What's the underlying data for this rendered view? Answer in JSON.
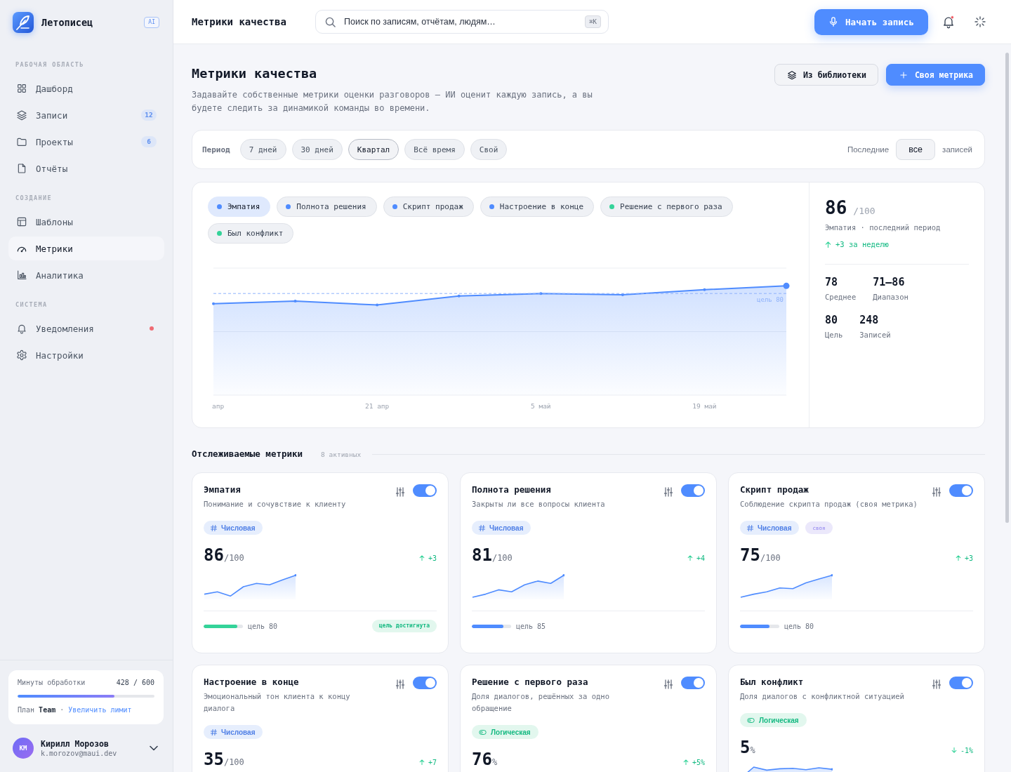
{
  "sidebar": {
    "app_name": "Летописец",
    "app_badge": "AI",
    "sections": [
      {
        "title": "РАБОЧАЯ ОБЛАСТЬ",
        "items": [
          {
            "label": "Дашборд",
            "selected": false,
            "unread": false
          },
          {
            "label": "Записи",
            "badge": "12",
            "selected": false,
            "unread": false
          },
          {
            "label": "Проекты",
            "badge": "6",
            "selected": false,
            "unread": false
          },
          {
            "label": "Отчёты",
            "selected": false,
            "unread": false
          }
        ]
      },
      {
        "title": "СОЗДАНИЕ",
        "items": [
          {
            "label": "Шаблоны",
            "selected": false,
            "unread": false
          },
          {
            "label": "Метрики",
            "selected": true,
            "unread": false
          },
          {
            "label": "Аналитика",
            "selected": false,
            "unread": false
          }
        ]
      },
      {
        "title": "СИСТЕМА",
        "items": [
          {
            "label": "Уведомления",
            "selected": false,
            "unread": true
          },
          {
            "label": "Настройки",
            "selected": false,
            "unread": false
          }
        ]
      }
    ],
    "usage": {
      "label": "Минуты обработки",
      "reading": "428 / 600",
      "level": 0.71,
      "plan": "План **Team** ·",
      "link": "Увеличить лимит"
    },
    "user": {
      "initials": "КМ",
      "name": "Кирилл Морозов",
      "email": "k.morozov@maui.dev"
    }
  },
  "header": {
    "title": "Метрики качества",
    "search": {
      "placeholder": "Поиск по записям, отчётам, людям…",
      "shortcut": "⌘K"
    },
    "record_button": "Начать запись",
    "notifications_unread": true
  },
  "page": {
    "title": "Метрики качества",
    "description": "Задавайте собственные метрики оценки разговоров — ИИ оценит каждую запись, а вы будете следить за динамикой команды во времени.",
    "buttons": [
      {
        "kind": "library",
        "label": "Из библиотеки"
      },
      {
        "kind": "create",
        "label": "Своя метрика"
      }
    ]
  },
  "period_filter": {
    "label": "Период",
    "options": [
      {
        "label": "7 дней",
        "selected": false
      },
      {
        "label": "30 дней",
        "selected": false
      },
      {
        "label": "Квартал",
        "selected": true
      },
      {
        "label": "Всё время",
        "selected": false
      },
      {
        "label": "Свой",
        "selected": false
      }
    ],
    "limit": {
      "prefix": "Последние",
      "value": "все",
      "suffix": "записей"
    }
  },
  "chart_panel": {
    "chips": [
      {
        "label": "Эмпатия",
        "color": "#4f8cff",
        "selected": true
      },
      {
        "label": "Полнота решения",
        "color": "#4f8cff",
        "selected": false
      },
      {
        "label": "Скрипт продаж",
        "color": "#4f8cff",
        "selected": false
      },
      {
        "label": "Настроение в конце",
        "color": "#4f8cff",
        "selected": false
      },
      {
        "label": "Решение с первого раза",
        "color": "#34d399",
        "selected": false
      },
      {
        "label": "Был конфликт",
        "color": "#34d399",
        "selected": false
      }
    ],
    "trend_chart": {
      "x_labels": [
        "апр",
        "21 апр",
        "5 май",
        "19 май"
      ],
      "goal_label": "цель 80"
    },
    "summary": {
      "value": "86",
      "unit": "/100",
      "caption": "Эмпатия · последний период",
      "rising": true,
      "delta": "+3 за неделю",
      "stat_rows": [
        {
          "stats": [
            {
              "value": "78",
              "label": "Среднее"
            },
            {
              "value": "71–86",
              "label": "Диапазон"
            }
          ]
        },
        {
          "stats": [
            {
              "value": "80",
              "label": "Цель"
            },
            {
              "value": "248",
              "label": "Записей"
            }
          ]
        }
      ]
    }
  },
  "metrics": {
    "title": "Отслеживаемые метрики",
    "count": "8 активных",
    "cards": [
      {
        "title": "Эмпатия",
        "description": "Понимание и сочувствие к клиенту",
        "enabled": true,
        "tags": [
          {
            "kind": "numeric",
            "label": "Числовая"
          }
        ],
        "value": "86",
        "unit": "/100",
        "rising": true,
        "delta": "+3",
        "sparkline": true,
        "progress": {
          "level": 0.86,
          "label": "цель 80",
          "reached": true,
          "badge": "цель достигнута"
        }
      },
      {
        "title": "Полнота решения",
        "description": "Закрыты ли все вопросы клиента",
        "enabled": true,
        "tags": [
          {
            "kind": "numeric",
            "label": "Числовая"
          }
        ],
        "value": "81",
        "unit": "/100",
        "rising": true,
        "delta": "+4",
        "sparkline": true,
        "progress": {
          "level": 0.81,
          "label": "цель 85",
          "reached": false
        }
      },
      {
        "title": "Скрипт продаж",
        "description": "Соблюдение скрипта продаж (своя метрика)",
        "enabled": true,
        "tags": [
          {
            "kind": "numeric",
            "label": "Числовая"
          },
          {
            "kind": "custom",
            "label": "своя"
          }
        ],
        "value": "75",
        "unit": "/100",
        "rising": true,
        "delta": "+3",
        "sparkline": true,
        "progress": {
          "level": 0.75,
          "label": "цель 80",
          "reached": false
        }
      },
      {
        "title": "Настроение в конце",
        "description": "Эмоциональный тон клиента к концу диалога",
        "enabled": true,
        "tags": [
          {
            "kind": "numeric",
            "label": "Числовая"
          }
        ],
        "value": "35",
        "unit": "/100",
        "rising": true,
        "delta": "+7",
        "sparkline": false
      },
      {
        "title": "Решение с первого раза",
        "description": "Доля диалогов, решённых за одно обращение",
        "enabled": true,
        "tags": [
          {
            "kind": "boolean",
            "label": "Логическая"
          }
        ],
        "value": "76",
        "unit": "%",
        "rising": true,
        "delta": "+5%",
        "sparkline": false
      },
      {
        "title": "Был конфликт",
        "description": "Доля диалогов с конфликтной ситуацией",
        "enabled": true,
        "tags": [
          {
            "kind": "boolean",
            "label": "Логическая"
          }
        ],
        "value": "5",
        "unit": "%",
        "rising": false,
        "delta": "-1%",
        "sparkline": true
      }
    ]
  }
}
